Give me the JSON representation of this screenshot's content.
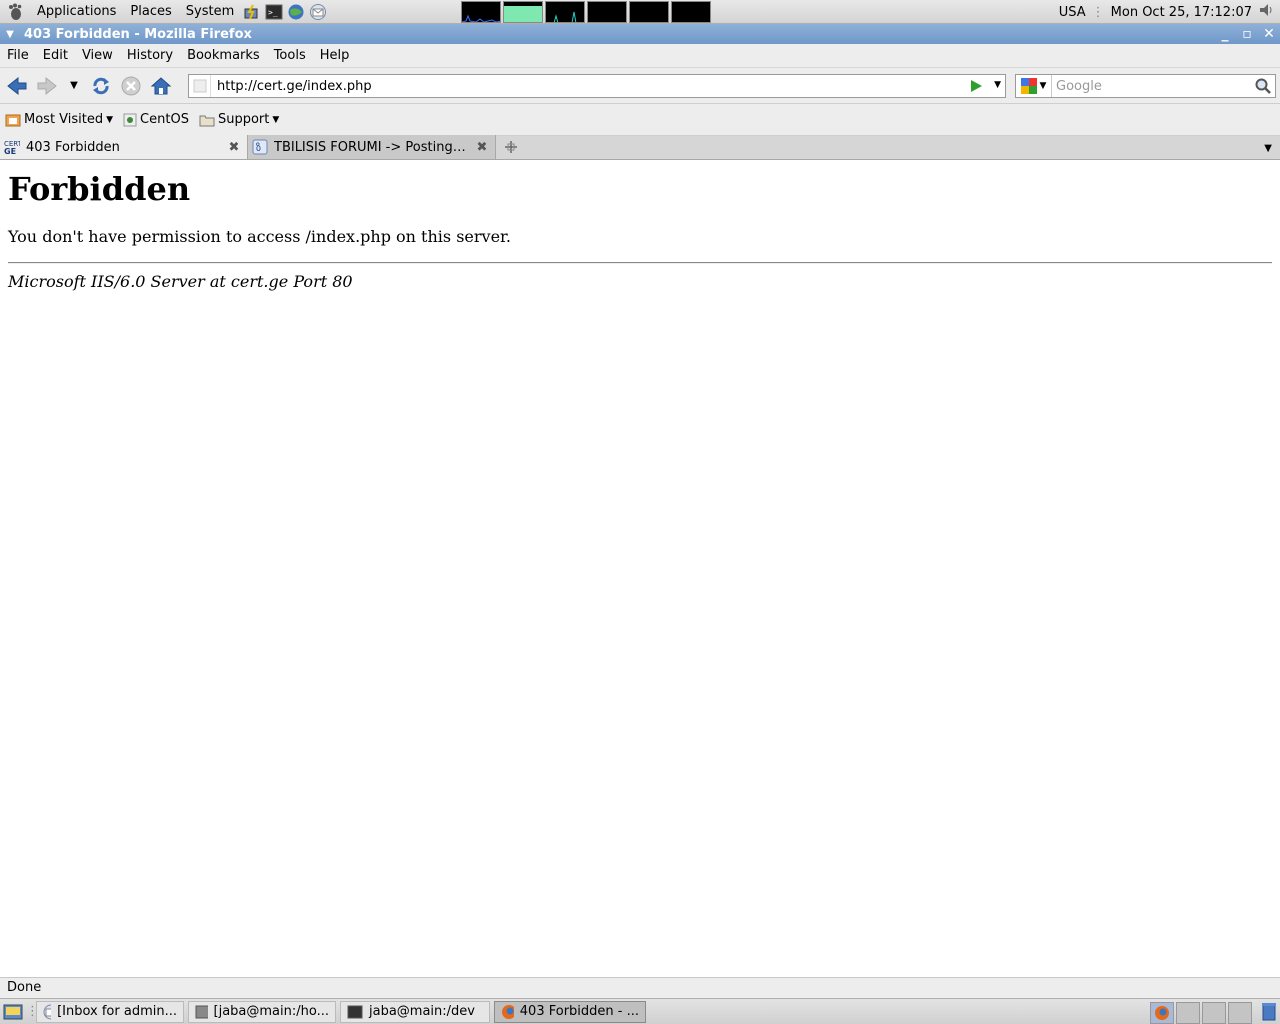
{
  "top_panel": {
    "menus": [
      "Applications",
      "Places",
      "System"
    ],
    "keyboard_layout": "USA",
    "clock": "Mon Oct 25, 17:12:07"
  },
  "window": {
    "title": "403 Forbidden - Mozilla Firefox"
  },
  "menubar": {
    "items": [
      "File",
      "Edit",
      "View",
      "History",
      "Bookmarks",
      "Tools",
      "Help"
    ]
  },
  "navigation": {
    "url": "http://cert.ge/index.php",
    "search_placeholder": "Google"
  },
  "bookmarks": {
    "items": [
      "Most Visited",
      "CentOS",
      "Support"
    ]
  },
  "tabs": [
    {
      "label": "403 Forbidden",
      "active": true
    },
    {
      "label": "TBILISIS FORUMI -> Posting N...",
      "active": false
    }
  ],
  "page": {
    "heading": "Forbidden",
    "message": "You don't have permission to access /index.php on this server.",
    "address": "Microsoft IIS/6.0 Server at cert.ge Port 80"
  },
  "status": {
    "text": "Done"
  },
  "taskbar": {
    "tasks": [
      {
        "label": "[Inbox for admin...",
        "icon": "mail-icon",
        "active": false
      },
      {
        "label": "[jaba@main:/ho...",
        "icon": "terminal-icon",
        "active": false
      },
      {
        "label": "jaba@main:/dev",
        "icon": "terminal-icon",
        "active": false
      },
      {
        "label": "403 Forbidden - ...",
        "icon": "firefox-icon",
        "active": true
      }
    ]
  },
  "colors": {
    "titlebar": "#7aa0cd",
    "accent_green": "#2ea02e",
    "nav_blue": "#3a6fb5"
  }
}
